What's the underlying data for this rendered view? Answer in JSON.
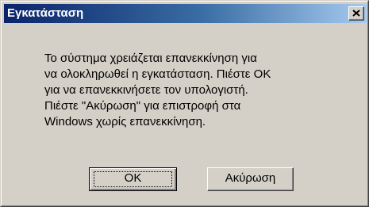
{
  "window": {
    "title": "Εγκατάσταση",
    "close_glyph": "close-icon"
  },
  "message": {
    "lines": [
      "Το σύστημα χρειάζεται επανεκκίνηση για",
      "να ολοκληρωθεί η εγκατάσταση. Πιέστε ΟΚ",
      "για να επανεκκινήσετε τον υπολογιστή.",
      "Πιέστε \"Ακύρωση\" για επιστροφή στα",
      "Windows χωρίς επανεκκίνηση."
    ]
  },
  "buttons": {
    "ok_label": "OK",
    "cancel_label": "Ακύρωση"
  },
  "colors": {
    "titlebar_start": "#0a246a",
    "titlebar_end": "#a6caf0",
    "face": "#d4d0c8"
  }
}
